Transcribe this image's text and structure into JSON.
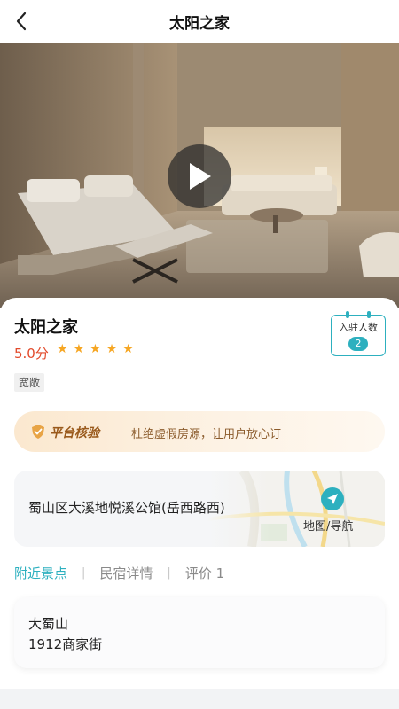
{
  "header": {
    "title": "太阳之家"
  },
  "gallery": {
    "total_slides": 3,
    "active_slide": 1
  },
  "listing": {
    "name": "太阳之家",
    "score": "5.0分",
    "stars": 5,
    "tags": [
      "宽敞"
    ],
    "resident": {
      "label": "入驻人数",
      "count": "2"
    }
  },
  "verify": {
    "title": "平台核验",
    "desc": "杜绝虚假房源，让用户放心订"
  },
  "location": {
    "address": "蜀山区大溪地悦溪公馆(岳西路西)",
    "nav_label": "地图/导航"
  },
  "tabs": [
    {
      "label": "附近景点",
      "active": true
    },
    {
      "label": "民宿详情",
      "active": false
    },
    {
      "label": "评价 1",
      "active": false
    }
  ],
  "nearby": [
    "大蜀山",
    "1912商家街"
  ],
  "colors": {
    "accent": "#2db0bf",
    "score": "#e24a2b",
    "star": "#f6a623",
    "verify_text": "#9a5a1c"
  }
}
